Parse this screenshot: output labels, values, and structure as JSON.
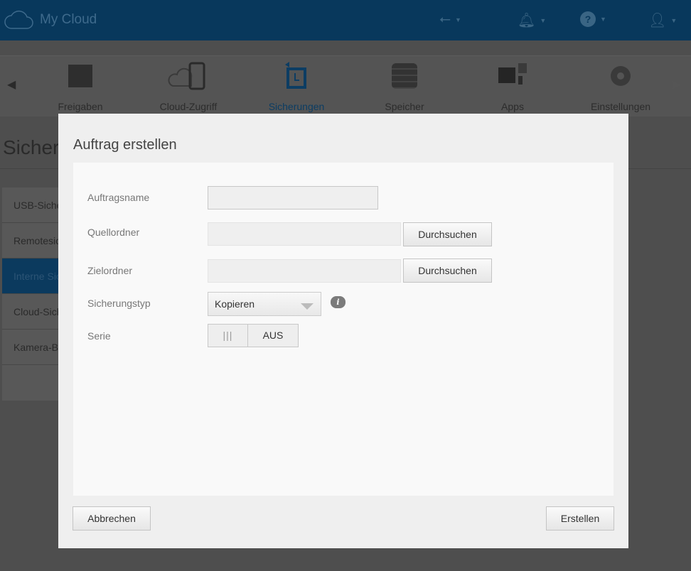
{
  "header": {
    "app_name": "My Cloud",
    "icons": [
      "usb-icon",
      "bell-icon",
      "help-icon",
      "user-icon"
    ]
  },
  "nav": {
    "items": [
      {
        "label": "Freigaben",
        "icon": "folder-icon"
      },
      {
        "label": "Cloud-Zugriff",
        "icon": "cloud-phone-icon"
      },
      {
        "label": "Sicherungen",
        "icon": "backup-icon",
        "active": true
      },
      {
        "label": "Speicher",
        "icon": "storage-icon"
      },
      {
        "label": "Apps",
        "icon": "apps-icon"
      },
      {
        "label": "Einstellungen",
        "icon": "gear-icon"
      }
    ]
  },
  "page": {
    "title": "Sicherungen"
  },
  "sidebar": {
    "items": [
      {
        "label": "USB-Sicherungen"
      },
      {
        "label": "Remotesicherungen"
      },
      {
        "label": "Interne Sicherungen",
        "selected": true
      },
      {
        "label": "Cloud-Sicherungen"
      },
      {
        "label": "Kamera-Backup"
      }
    ]
  },
  "dialog": {
    "title": "Auftrag erstellen",
    "fields": {
      "job_name": {
        "label": "Auftragsname",
        "value": ""
      },
      "source": {
        "label": "Quellordner",
        "value": "",
        "browse": "Durchsuchen"
      },
      "target": {
        "label": "Zielordner",
        "value": "",
        "browse": "Durchsuchen"
      },
      "type": {
        "label": "Sicherungstyp",
        "value": "Kopieren"
      },
      "series": {
        "label": "Serie",
        "grip": "|||",
        "state": "AUS"
      }
    },
    "cancel": "Abbrechen",
    "create": "Erstellen"
  }
}
